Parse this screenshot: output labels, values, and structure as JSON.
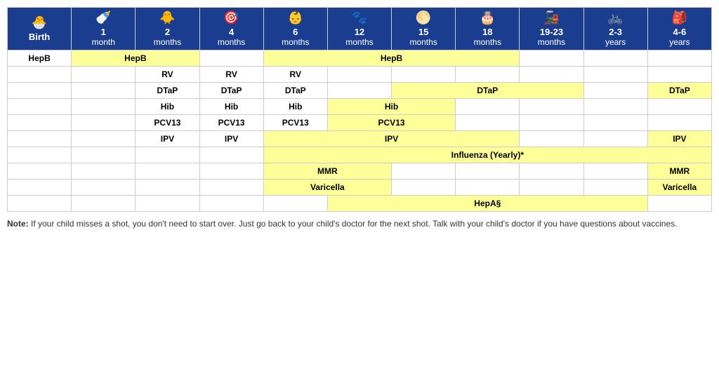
{
  "headers": [
    {
      "icon": "🐣",
      "main": "Birth",
      "sub": ""
    },
    {
      "icon": "🍼",
      "main": "1",
      "sub": "month"
    },
    {
      "icon": "🐥",
      "main": "2",
      "sub": "months"
    },
    {
      "icon": "🎯",
      "main": "4",
      "sub": "months"
    },
    {
      "icon": "👶",
      "main": "6",
      "sub": "months"
    },
    {
      "icon": "🐾",
      "main": "12",
      "sub": "months"
    },
    {
      "icon": "🌕",
      "main": "15",
      "sub": "months"
    },
    {
      "icon": "🎂",
      "main": "18",
      "sub": "months"
    },
    {
      "icon": "🚂",
      "main": "19-23",
      "sub": "months"
    },
    {
      "icon": "🚲",
      "main": "2-3",
      "sub": "years"
    },
    {
      "icon": "🎒",
      "main": "4-6",
      "sub": "years"
    }
  ],
  "vaccines": {
    "HepB": "HepB",
    "RV": "RV",
    "DTaP": "DTaP",
    "Hib": "Hib",
    "PCV13": "PCV13",
    "IPV": "IPV",
    "Influenza": "Influenza (Yearly)*",
    "MMR": "MMR",
    "Varicella": "Varicella",
    "HepA": "HepA§"
  },
  "note": {
    "bold": "Note:",
    "text": " If your child misses a shot, you don't need to start over. Just go back to your child's doctor for the next shot. Talk with your child's doctor if you have questions about vaccines."
  }
}
